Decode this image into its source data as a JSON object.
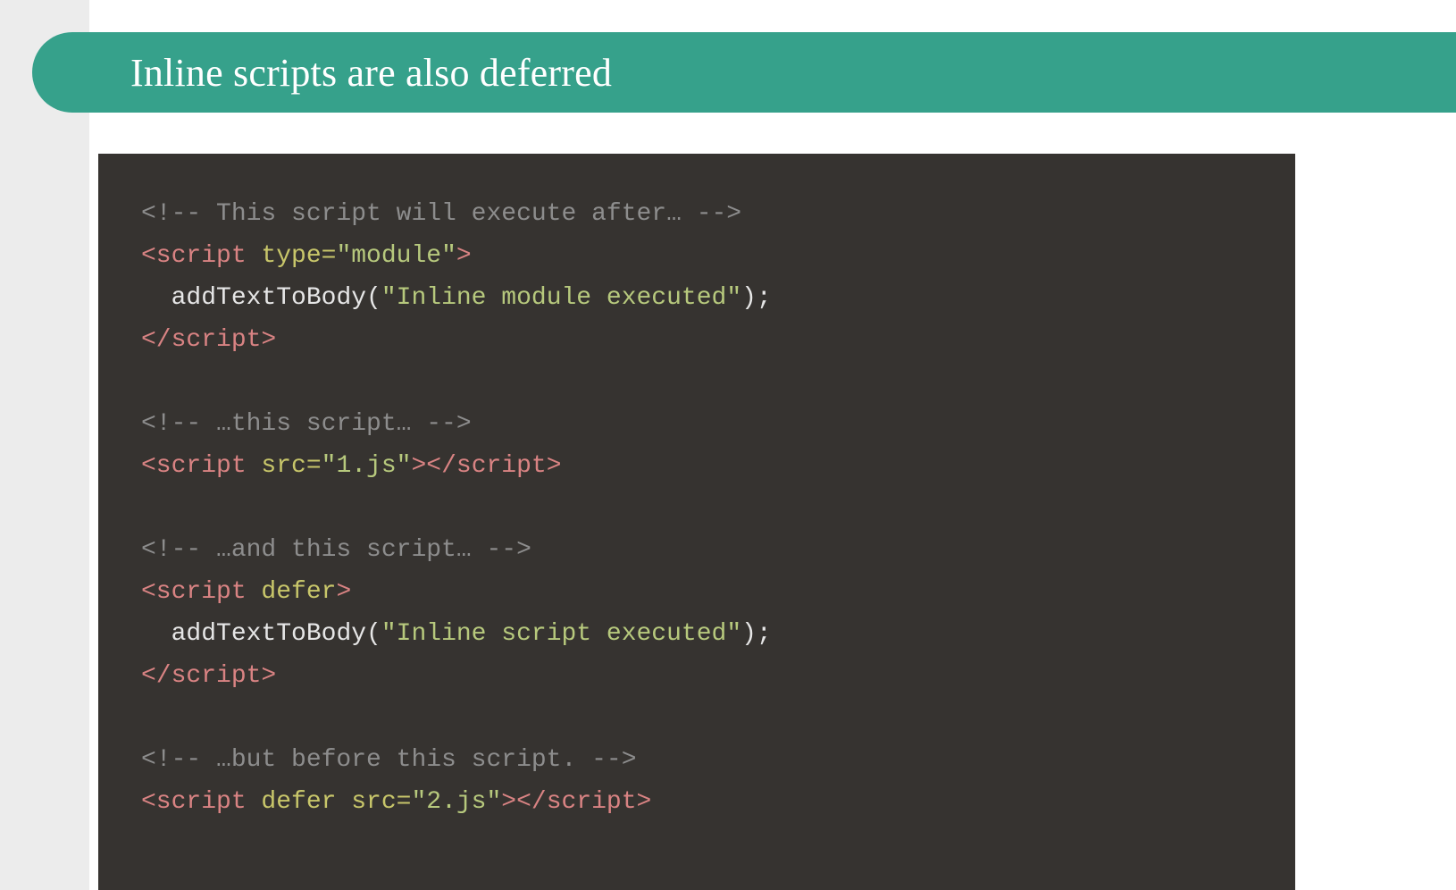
{
  "title": "Inline scripts are also deferred",
  "colors": {
    "accent": "#36a18b",
    "gutter": "#ececec",
    "code_bg": "#363330",
    "comment": "#8d8d8d",
    "tag": "#d98383",
    "attr": "#c8c66a",
    "string": "#b7c97d",
    "default": "#e6e6e6"
  },
  "code": {
    "comment1": "<!-- This script will execute after… -->",
    "block1": {
      "open_tag_name": "<script",
      "type_attr": " type=",
      "type_value": "\"module\"",
      "open_tag_close": ">",
      "body_indent": "  ",
      "fn_call": "addTextToBody(",
      "fn_arg": "\"Inline module executed\"",
      "fn_tail": ");",
      "close_tag": "</script>"
    },
    "comment2": "<!-- …this script… -->",
    "block2": {
      "open_tag_name": "<script",
      "src_attr": " src=",
      "src_value": "\"1.js\"",
      "open_tag_close": ">",
      "close_tag": "</script>"
    },
    "comment3": "<!-- …and this script… -->",
    "block3": {
      "open_tag_name": "<script",
      "defer_attr": " defer",
      "open_tag_close": ">",
      "body_indent": "  ",
      "fn_call": "addTextToBody(",
      "fn_arg": "\"Inline script executed\"",
      "fn_tail": ");",
      "close_tag": "</script>"
    },
    "comment4": "<!-- …but before this script. -->",
    "block4": {
      "open_tag_name": "<script",
      "defer_attr": " defer",
      "src_attr": " src=",
      "src_value": "\"2.js\"",
      "open_tag_close": ">",
      "close_tag": "</script>"
    }
  }
}
